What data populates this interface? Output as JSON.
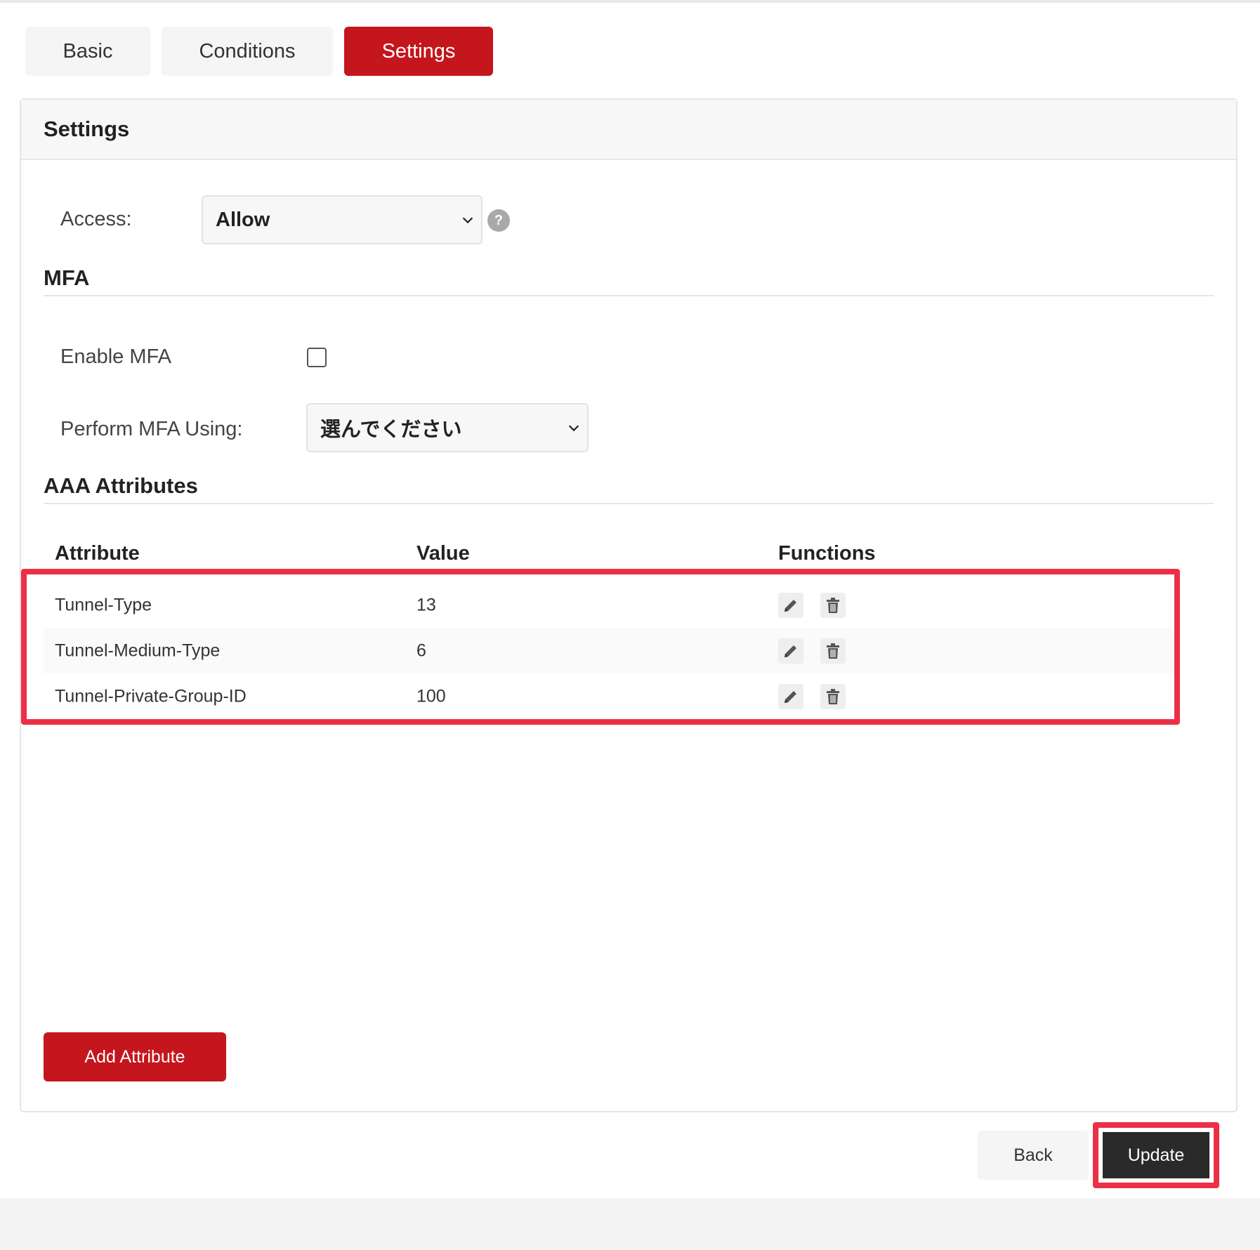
{
  "tabs": [
    {
      "label": "Basic",
      "active": false
    },
    {
      "label": "Conditions",
      "active": false
    },
    {
      "label": "Settings",
      "active": true
    }
  ],
  "panel": {
    "title": "Settings"
  },
  "access": {
    "label": "Access:",
    "value": "Allow",
    "help_icon": "question-mark"
  },
  "mfa": {
    "title": "MFA",
    "enable_label": "Enable MFA",
    "enable_checked": false,
    "perform_label": "Perform MFA Using:",
    "perform_value": "選んでください"
  },
  "aaa": {
    "title": "AAA Attributes",
    "headers": {
      "attribute": "Attribute",
      "value": "Value",
      "functions": "Functions"
    },
    "rows": [
      {
        "attribute": "Tunnel-Type",
        "value": "13"
      },
      {
        "attribute": "Tunnel-Medium-Type",
        "value": "6"
      },
      {
        "attribute": "Tunnel-Private-Group-ID",
        "value": "100"
      }
    ],
    "function_icons": [
      "pencil-icon",
      "trash-icon"
    ],
    "add_button": "Add Attribute"
  },
  "footer": {
    "back_label": "Back",
    "update_label": "Update"
  },
  "colors": {
    "brand_red": "#c4161c",
    "highlight": "#ec2f45",
    "dark_button": "#2a2a2a"
  }
}
